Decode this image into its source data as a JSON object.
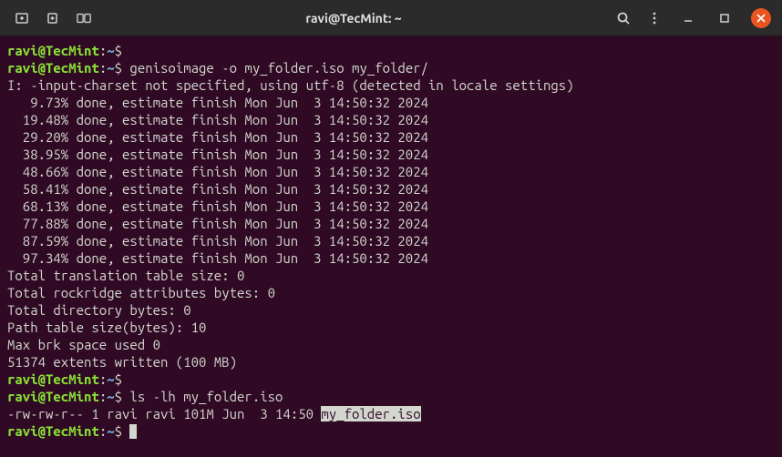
{
  "titlebar": {
    "title": "ravi@TecMint: ~"
  },
  "prompt": {
    "user_host": "ravi@TecMint",
    "colon": ":",
    "path": "~",
    "dollar": "$"
  },
  "commands": {
    "cmd1": " genisoimage -o my_folder.iso my_folder/",
    "cmd2": " ls -lh my_folder.iso"
  },
  "output": {
    "charset": "I: -input-charset not specified, using utf-8 (detected in locale settings)",
    "p1": "   9.73% done, estimate finish Mon Jun  3 14:50:32 2024",
    "p2": "  19.48% done, estimate finish Mon Jun  3 14:50:32 2024",
    "p3": "  29.20% done, estimate finish Mon Jun  3 14:50:32 2024",
    "p4": "  38.95% done, estimate finish Mon Jun  3 14:50:32 2024",
    "p5": "  48.66% done, estimate finish Mon Jun  3 14:50:32 2024",
    "p6": "  58.41% done, estimate finish Mon Jun  3 14:50:32 2024",
    "p7": "  68.13% done, estimate finish Mon Jun  3 14:50:32 2024",
    "p8": "  77.88% done, estimate finish Mon Jun  3 14:50:32 2024",
    "p9": "  87.59% done, estimate finish Mon Jun  3 14:50:32 2024",
    "p10": "  97.34% done, estimate finish Mon Jun  3 14:50:32 2024",
    "tts": "Total translation table size: 0",
    "trab": "Total rockridge attributes bytes: 0",
    "tdb": "Total directory bytes: 0",
    "pts": "Path table size(bytes): 10",
    "mbs": "Max brk space used 0",
    "ext": "51374 extents written (100 MB)",
    "ls_prefix": "-rw-rw-r-- 1 ravi ravi 101M Jun  3 14:50 ",
    "ls_file": "my_folder.iso"
  }
}
